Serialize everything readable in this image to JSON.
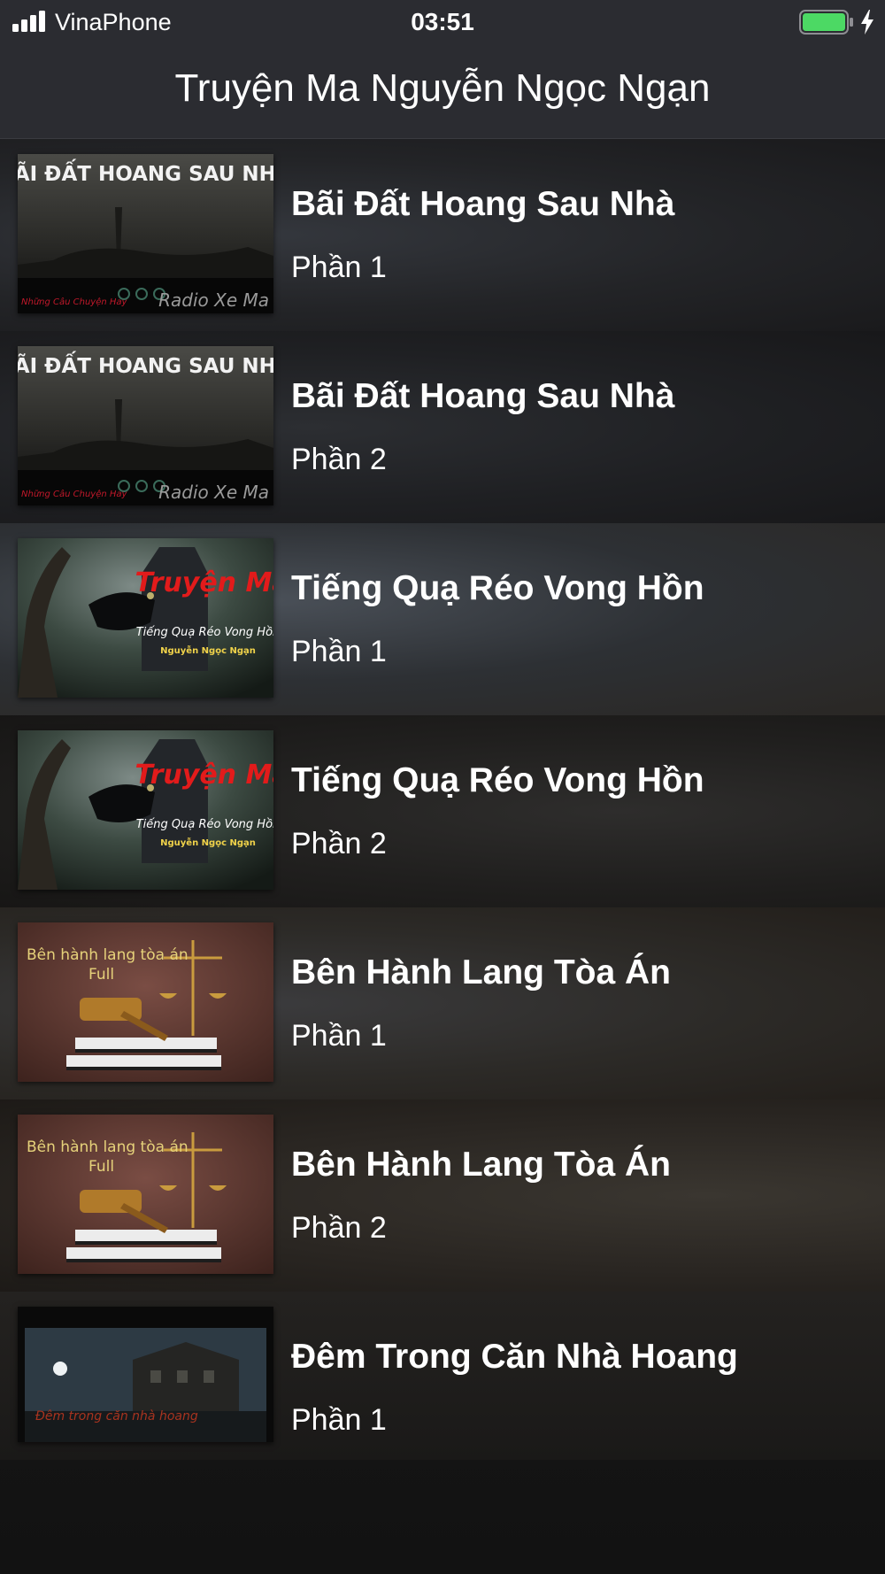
{
  "status_bar": {
    "carrier": "VinaPhone",
    "time": "03:51",
    "signal_icon": "signal-bars-icon",
    "battery_icon": "battery-full-icon",
    "charging_icon": "charging-bolt-icon",
    "battery_color": "#4cd964"
  },
  "nav": {
    "title": "Truyện Ma Nguyễn Ngọc Ngạn"
  },
  "stories": [
    {
      "title": "Bãi Đất Hoang Sau Nhà",
      "part": "Phần 1",
      "thumb": {
        "text": "BÃI ĐẤT HOANG SAU NHÀ",
        "sub_left": "Những Câu Chuyện Hay",
        "sub_right": "Radio Xe Ma"
      }
    },
    {
      "title": "Bãi Đất Hoang Sau Nhà",
      "part": "Phần 2",
      "thumb": {
        "text": "BÃI ĐẤT HOANG SAU NHÀ",
        "sub_left": "Những Câu Chuyện Hay",
        "sub_right": "Radio Xe Ma"
      }
    },
    {
      "title": "Tiếng Quạ Réo Vong Hồn",
      "part": "Phần 1",
      "thumb": {
        "text": "Truyện Ma",
        "sub": "Tiếng Quạ Réo Vong Hồn",
        "author": "Nguyễn Ngọc Ngạn"
      }
    },
    {
      "title": "Tiếng Quạ Réo Vong Hồn",
      "part": "Phần 2",
      "thumb": {
        "text": "Truyện Ma",
        "sub": "Tiếng Quạ Réo Vong Hồn",
        "author": "Nguyễn Ngọc Ngạn"
      }
    },
    {
      "title": "Bên Hành Lang Tòa Án",
      "part": "Phần 1",
      "thumb": {
        "text": "Bên hành lang tòa án",
        "sub": "Full"
      }
    },
    {
      "title": "Bên Hành Lang Tòa Án",
      "part": "Phần 2",
      "thumb": {
        "text": "Bên hành lang tòa án",
        "sub": "Full"
      }
    },
    {
      "title": "Đêm Trong Căn Nhà Hoang",
      "part": "Phần 1",
      "thumb": {
        "text": "Đêm trong căn nhà hoang"
      }
    }
  ]
}
